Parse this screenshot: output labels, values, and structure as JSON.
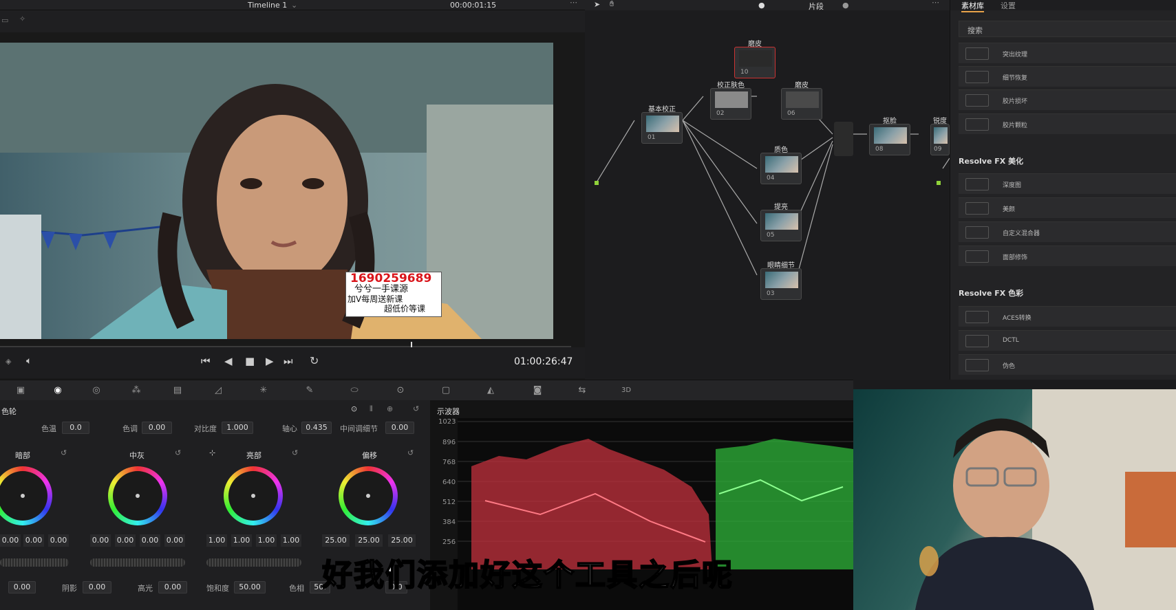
{
  "viewer": {
    "timeline_name": "Timeline 1",
    "timecode_top": "00:00:01:15",
    "timecode": "01:00:26:47",
    "watermark": {
      "line1": "1690259689",
      "line2": "兮兮一手课源",
      "line3": "加V每周送新课",
      "line4": "超低价等课"
    }
  },
  "node_editor": {
    "clip_label": "片段",
    "nodes": [
      {
        "label": "基本校正",
        "num": "01"
      },
      {
        "label": "校正肤色",
        "num": "02"
      },
      {
        "label": "磨皮",
        "num": "10"
      },
      {
        "label": "磨皮",
        "num": "06"
      },
      {
        "label": "质色",
        "num": "04"
      },
      {
        "label": "提亮",
        "num": "05"
      },
      {
        "label": "眼睛细节",
        "num": "03"
      },
      {
        "label": "抠脸",
        "num": "08"
      },
      {
        "label": "锐度",
        "num": "09"
      }
    ]
  },
  "library": {
    "tabs": [
      "素材库",
      "设置"
    ],
    "search_placeholder": "搜索",
    "items_top": [
      "突出纹理",
      "细节恢复",
      "胶片损坏",
      "胶片颗粒"
    ],
    "section_beauty": "Resolve FX 美化",
    "items_beauty": [
      "深度图",
      "美颜",
      "自定义混合器",
      "面部修饰"
    ],
    "section_color": "Resolve FX 色彩",
    "items_color": [
      "ACES转换",
      "DCTL",
      "伪色"
    ]
  },
  "wheels_panel": {
    "title": "色轮",
    "params": {
      "temp_label": "色温",
      "temp_value": "0.0",
      "tint_label": "色调",
      "tint_value": "0.00",
      "contrast_label": "对比度",
      "contrast_value": "1.000",
      "pivot_label": "轴心",
      "pivot_value": "0.435",
      "middetail_label": "中间调细节",
      "middetail_value": "0.00"
    },
    "wheels": [
      {
        "name": "暗部",
        "values": [
          "0.00",
          "0.00",
          "0.00"
        ]
      },
      {
        "name": "中灰",
        "values": [
          "0.00",
          "0.00",
          "0.00",
          "0.00"
        ]
      },
      {
        "name": "亮部",
        "values": [
          "1.00",
          "1.00",
          "1.00",
          "1.00"
        ]
      },
      {
        "name": "偏移",
        "values": [
          "25.00",
          "25.00",
          "25.00"
        ]
      }
    ],
    "bottom": {
      "v0": "0.00",
      "shadow_label": "阴影",
      "shadow_value": "0.00",
      "highlight_label": "高光",
      "highlight_value": "0.00",
      "sat_label": "饱和度",
      "sat_value": "50.00",
      "hue_label": "色相",
      "hue_value": "50.",
      "lum_value": "0.0"
    }
  },
  "scope": {
    "title": "示波器",
    "ticks": [
      "1023",
      "896",
      "768",
      "640",
      "512",
      "384",
      "256"
    ]
  },
  "subtitle": "好我们添加好这个工具之后呢",
  "colors": {
    "accent": "#e8a24a",
    "red_trace": "#e0414c",
    "green_trace": "#3fe045"
  }
}
